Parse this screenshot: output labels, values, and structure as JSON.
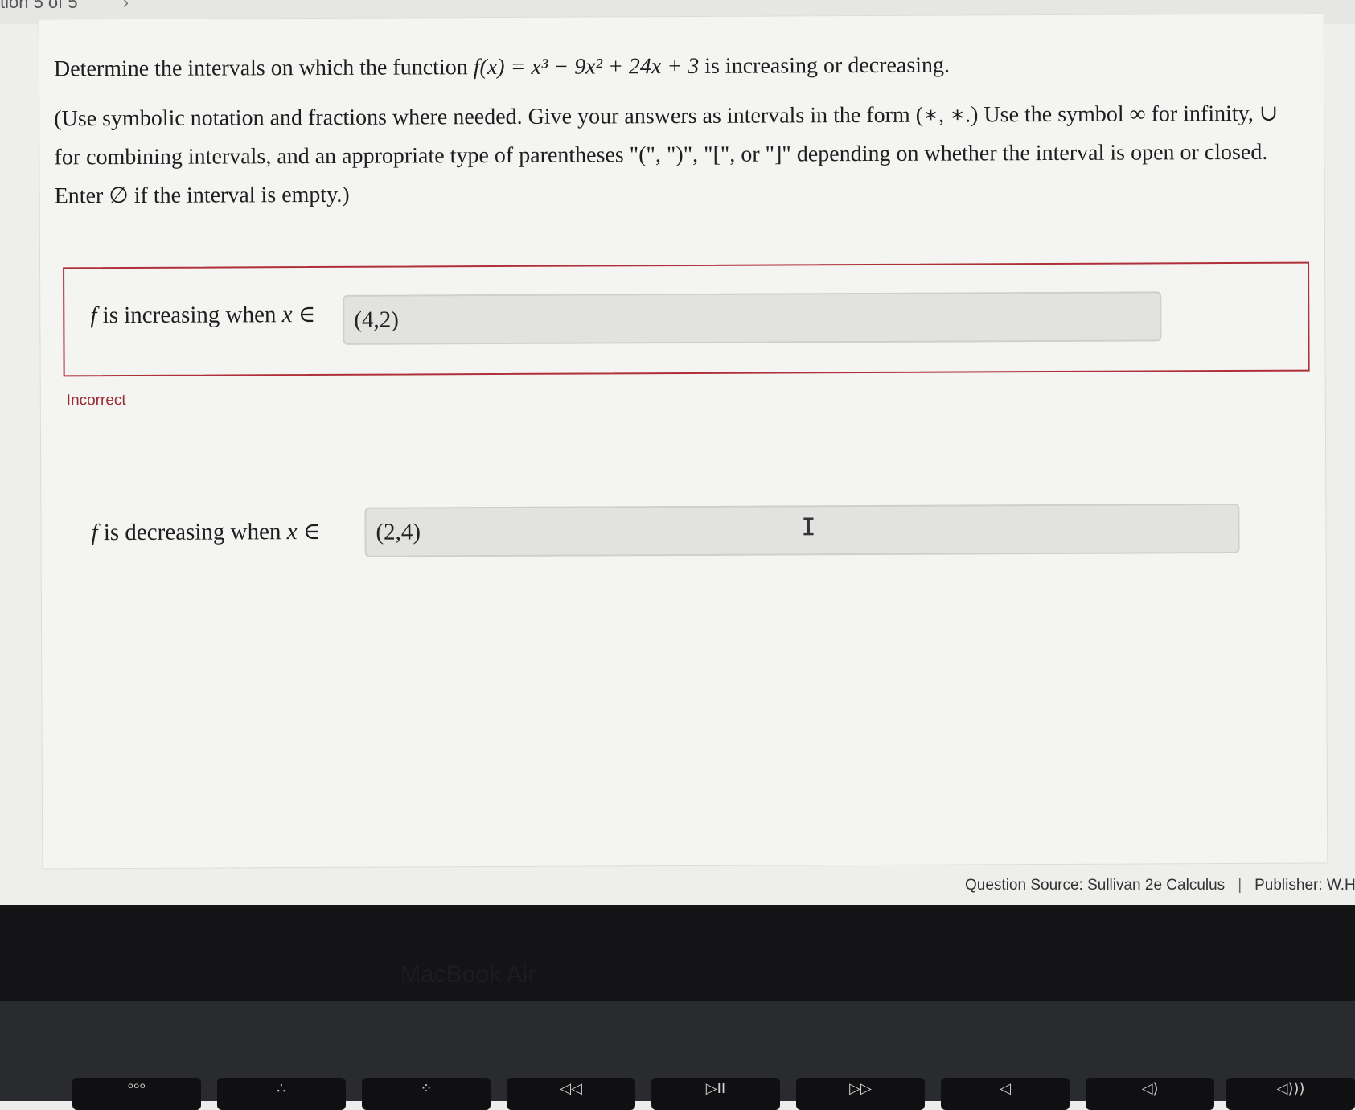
{
  "header": {
    "question_nav": "tion 5 of 5",
    "next_icon": "chevron-right-icon"
  },
  "prompt": {
    "pre": "Determine the intervals on which the function ",
    "function": "f(x) = x³ − 9x² + 24x + 3",
    "post": " is increasing or decreasing.",
    "instructions": "(Use symbolic notation and fractions where needed. Give your answers as intervals in the form (∗, ∗.) Use the symbol ∞ for infinity, ∪ for combining intervals, and an appropriate type of parentheses \"(\", \")\", \"[\", or \"]\" depending on whether the interval is open or closed. Enter ∅ if the interval is empty.)"
  },
  "increasing": {
    "label_f": "f",
    "label_mid": " is increasing when ",
    "label_x": "x",
    "label_in": " ∈",
    "value": "(4,2)",
    "status": "Incorrect"
  },
  "decreasing": {
    "label_f": "f",
    "label_mid": " is decreasing when ",
    "label_x": "x",
    "label_in": " ∈",
    "value": "(2,4)"
  },
  "footer": {
    "source": "Question Source: Sullivan 2e Calculus",
    "separator": "|",
    "publisher": "Publisher: W.H."
  },
  "device": {
    "bezel_label": "MacBook Air",
    "keys": [
      "ᵒᵒᵒ",
      "∴",
      "⁘",
      "◁◁",
      "▷II",
      "▷▷",
      "◁",
      "◁)",
      "◁)))"
    ]
  },
  "colors": {
    "error": "#b0303a",
    "incorrect_text": "#9b2a30",
    "field_bg": "#e2e2e0"
  }
}
